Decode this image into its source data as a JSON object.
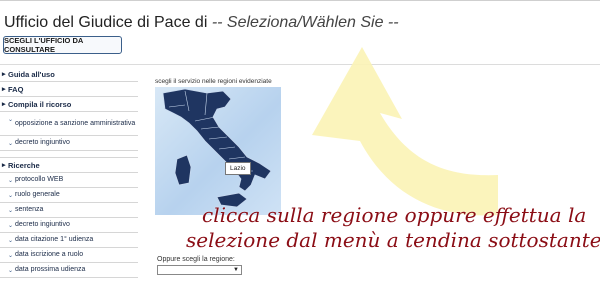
{
  "header": {
    "title": "Ufficio del Giudice di Pace di",
    "selection": "-- Seleziona/Wählen Sie --",
    "button_label": "SCEGLI L'UFFICIO DA CONSULTARE"
  },
  "sidebar": {
    "sections": [
      {
        "label": "Guida all'uso",
        "items": []
      },
      {
        "label": "FAQ",
        "items": []
      },
      {
        "label": "Compila il ricorso",
        "items": [
          "opposizione a sanzione amministrativa",
          "decreto ingiuntivo"
        ]
      },
      {
        "label": "Ricerche",
        "items": [
          "protocollo WEB",
          "ruolo generale",
          "sentenza",
          "decreto ingiuntivo",
          "data citazione 1° udienza",
          "data iscrizione a ruolo",
          "data prossima udienza"
        ]
      }
    ]
  },
  "map": {
    "caption": "scegli il servizio nelle regioni evidenziate",
    "tooltip": "Lazio"
  },
  "hint": {
    "line1": "clicca sulla regione oppure effettua la",
    "line2": "selezione dal menù a tendina sottostante"
  },
  "region_select": {
    "label": "Oppure scegli la regione:",
    "value": ""
  },
  "colors": {
    "arrow": "#fbf3b5",
    "map_land": "#1f3561",
    "sea": "#c5dcf2",
    "hint_text": "#8b0d15",
    "button_border": "#3b5f8a"
  }
}
